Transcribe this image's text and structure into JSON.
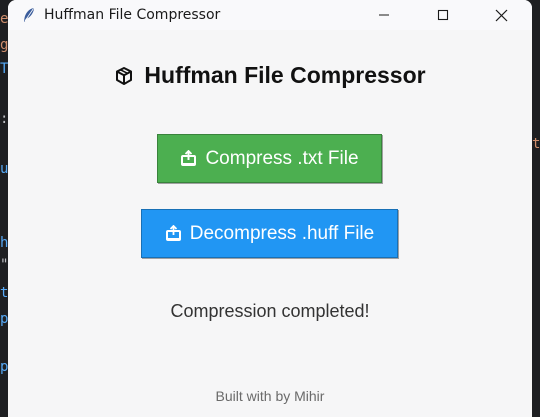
{
  "window": {
    "title": "Huffman File Compressor"
  },
  "app": {
    "heading": "Huffman File Compressor",
    "heading_icon": "package-box-icon",
    "compress_label": "Compress .txt File",
    "decompress_label": "Decompress .huff File",
    "button_icon": "upload-tray-icon",
    "status": "Compression completed!",
    "footer": "Built with by Mihir"
  },
  "background_editor": {
    "chars": [
      "e",
      "g",
      "T",
      ":",
      "u",
      "h",
      "\"",
      "t",
      "p",
      "p"
    ],
    "right_char": "t"
  },
  "colors": {
    "compress": "#4caf50",
    "decompress": "#2196f3"
  }
}
